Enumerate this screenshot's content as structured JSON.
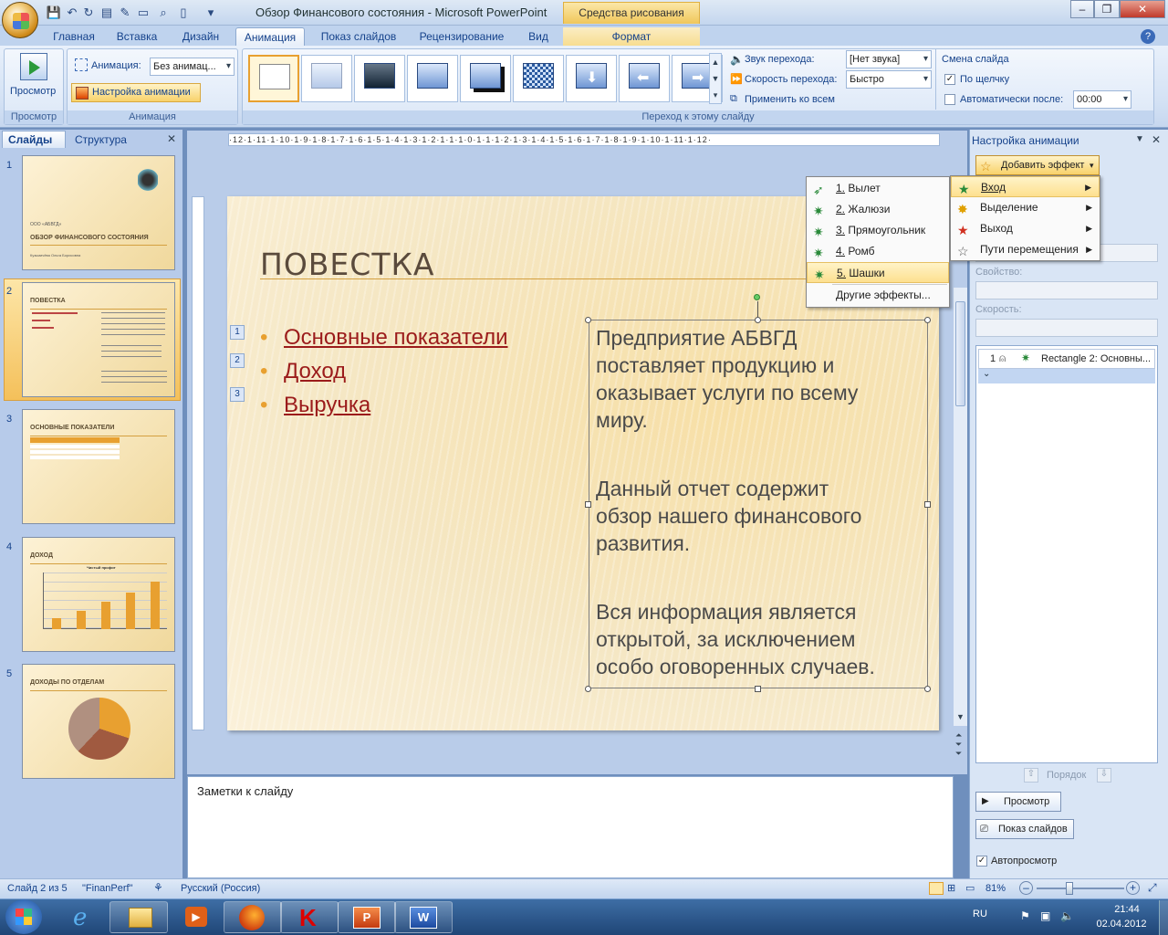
{
  "window": {
    "title": "Обзор Финансового состояния - Microsoft PowerPoint",
    "context_tab": "Средства рисования"
  },
  "tabs": [
    "Главная",
    "Вставка",
    "Дизайн",
    "Анимация",
    "Показ слайдов",
    "Рецензирование",
    "Вид",
    "Формат"
  ],
  "ribbon": {
    "preview_label": "Просмотр",
    "preview_group": "Просмотр",
    "animation_label": "Анимация:",
    "animation_value": "Без анимац...",
    "custom_animation": "Настройка анимации",
    "animations_group": "Анимация",
    "sound_label": "Звук перехода:",
    "sound_value": "[Нет звука]",
    "speed_label": "Скорость перехода:",
    "speed_value": "Быстро",
    "apply_all": "Применить ко всем",
    "transition_group": "Переход к этому слайду",
    "advance_title": "Смена слайда",
    "on_click": "По щелчку",
    "auto_after": "Автоматически после:",
    "auto_time": "00:00"
  },
  "left_pane": {
    "tab_slides": "Слайды",
    "tab_outline": "Структура",
    "slides": [
      {
        "num": "1",
        "title": "ОБЗОР ФИНАНСОВОГО СОСТОЯНИЯ",
        "sub": "ООО «АБВГД»",
        "author": "Кузьмичёва Ольга Борисовна"
      },
      {
        "num": "2",
        "title": "ПОВЕСТКА"
      },
      {
        "num": "3",
        "title": "ОСНОВНЫЕ ПОКАЗАТЕЛИ"
      },
      {
        "num": "4",
        "title": "ДОХОД",
        "chart_title": "Чистый профит"
      },
      {
        "num": "5",
        "title": "ДОХОДЫ ПО ОТДЕЛАМ"
      }
    ]
  },
  "ruler": {
    "h": "·12·1·11·1·10·1·9·1·8·1·7·1·6·1·5·1·4·1·3·1·2·1·1·1·0·1·1·1·2·1·3·1·4·1·5·1·6·1·7·1·8·1·9·1·10·1·11·1·12·"
  },
  "slide": {
    "title": "ПОВЕСТКА",
    "bullets": [
      {
        "n": "1",
        "text": "Основные показатели"
      },
      {
        "n": "2",
        "text": "Доход"
      },
      {
        "n": "3",
        "text": "Выручка"
      }
    ],
    "body": [
      "Предприятие АБВГД",
      "поставляет продукцию и",
      "оказывает услуги по всему",
      "миру.",
      "Данный отчет содержит",
      "обзор нашего финансового",
      "развития.",
      "Вся информация является",
      "открытой, за исключением",
      "особо оговоренных случаев."
    ]
  },
  "notes_placeholder": "Заметки к слайду",
  "task_pane": {
    "title": "Настройка анимации",
    "add_effect": "Добавить эффект",
    "property": "Свойство:",
    "speed": "Скорость:",
    "list_item_num": "1",
    "list_item": "Rectangle 2: Основны...",
    "order": "Порядок",
    "preview": "Просмотр",
    "slideshow": "Показ слайдов",
    "autopreview": "Автопросмотр"
  },
  "menu_main": [
    {
      "label": "Вход"
    },
    {
      "label": "Выделение"
    },
    {
      "label": "Выход"
    },
    {
      "label": "Пути перемещения"
    }
  ],
  "menu_sub": [
    {
      "num": "1.",
      "label": "Вылет"
    },
    {
      "num": "2.",
      "label": "Жалюзи"
    },
    {
      "num": "3.",
      "label": "Прямоугольник"
    },
    {
      "num": "4.",
      "label": "Ромб"
    },
    {
      "num": "5.",
      "label": "Шашки"
    },
    {
      "num": "",
      "label": "Другие эффекты..."
    }
  ],
  "status": {
    "slide": "Слайд 2 из 5",
    "theme": "\"FinanPerf\"",
    "lang": "Русский (Россия)",
    "zoom": "81%"
  },
  "tray": {
    "lang": "RU",
    "time": "21:44",
    "date": "02.04.2012"
  },
  "colors": {
    "accent": "#e8a030",
    "link": "#9b1b1b",
    "ribbon": "#d3e1f4"
  }
}
